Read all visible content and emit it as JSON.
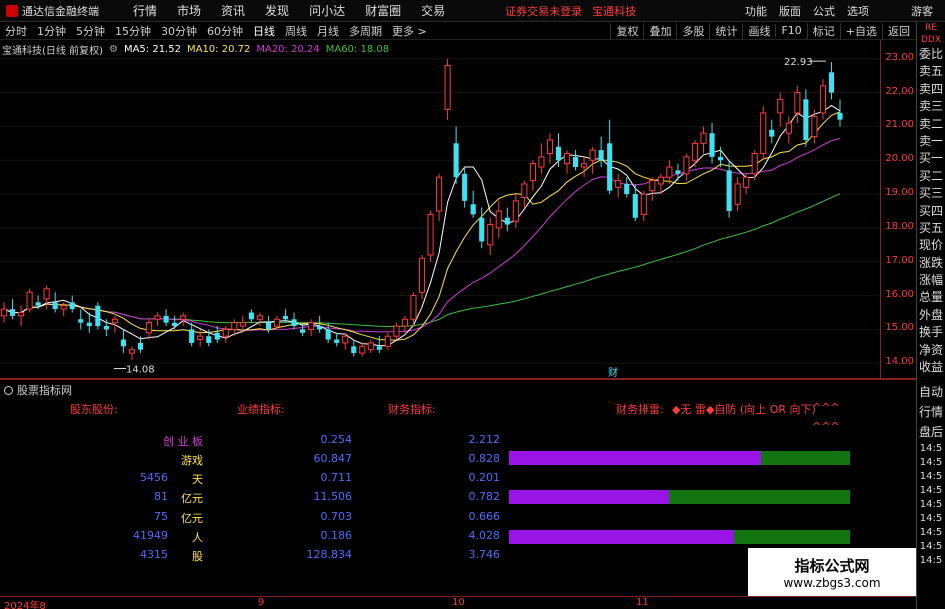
{
  "menubar": {
    "app_title": "通达信金融终端",
    "items": [
      "行情",
      "市场",
      "资讯",
      "发现",
      "问小达",
      "财富圈",
      "交易"
    ],
    "status_warn": "证券交易未登录",
    "status_stock": "宝通科技",
    "right_items": [
      "功能",
      "版面",
      "公式",
      "选项"
    ],
    "guest": "游客"
  },
  "toolbar": {
    "periods": [
      "分时",
      "1分钟",
      "5分钟",
      "15分钟",
      "30分钟",
      "60分钟",
      "日线",
      "周线",
      "月线",
      "多周期",
      "更多 >"
    ],
    "active": "日线",
    "buttons": [
      "复权",
      "叠加",
      "多股",
      "统计",
      "画线",
      "F10",
      "标记",
      "+自选",
      "返回"
    ]
  },
  "legend": {
    "stock": "宝通科技(日线 前复权)",
    "ma5": "MA5: 21.52",
    "ma10": "MA10: 20.72",
    "ma20": "MA20: 20.24",
    "ma60": "MA60: 18.08"
  },
  "colors": {
    "up": "#ff3b3b",
    "down": "#3fe0f0",
    "ma5": "#ffffff",
    "ma10": "#ffe34a",
    "ma20": "#d23ad6",
    "ma60": "#3fbf3f",
    "bar_purple": "#9b14e6",
    "bar_green": "#127512"
  },
  "chart_data": {
    "type": "candlestick",
    "ylim": [
      13.8,
      23.2
    ],
    "yticks": [
      "23.00",
      "22.00",
      "21.00",
      "20.00",
      "19.00",
      "18.00",
      "17.00",
      "16.00",
      "15.00",
      "14.00"
    ],
    "ytick_values": [
      23,
      22,
      21,
      20,
      19,
      18,
      17,
      16,
      15,
      14
    ],
    "high_label": "22.93",
    "low_label": "14.08",
    "marker": "财",
    "candles": [
      [
        15.4,
        15.8,
        15.2,
        15.6
      ],
      [
        15.6,
        15.9,
        15.3,
        15.4
      ],
      [
        15.4,
        15.7,
        15.1,
        15.5
      ],
      [
        15.6,
        16.2,
        15.5,
        16.1
      ],
      [
        15.8,
        16.0,
        15.6,
        15.7
      ],
      [
        15.9,
        16.3,
        15.6,
        16.2
      ],
      [
        15.8,
        16.1,
        15.5,
        15.6
      ],
      [
        15.6,
        15.8,
        15.4,
        15.7
      ],
      [
        15.8,
        16.0,
        15.5,
        15.6
      ],
      [
        15.3,
        15.6,
        15.0,
        15.2
      ],
      [
        15.2,
        15.5,
        14.9,
        15.1
      ],
      [
        15.7,
        15.8,
        15.0,
        15.1
      ],
      [
        15.1,
        15.3,
        14.8,
        15.0
      ],
      [
        15.2,
        15.4,
        14.9,
        15.3
      ],
      [
        14.7,
        15.0,
        14.3,
        14.5
      ],
      [
        14.3,
        14.5,
        14.1,
        14.4
      ],
      [
        14.6,
        14.8,
        14.3,
        14.4
      ],
      [
        14.9,
        15.3,
        14.7,
        15.2
      ],
      [
        15.3,
        15.5,
        15.1,
        15.4
      ],
      [
        15.4,
        15.6,
        15.1,
        15.2
      ],
      [
        15.2,
        15.4,
        15.0,
        15.1
      ],
      [
        15.3,
        15.5,
        15.1,
        15.4
      ],
      [
        15.0,
        15.2,
        14.5,
        14.6
      ],
      [
        14.7,
        15.0,
        14.5,
        14.8
      ],
      [
        14.8,
        15.0,
        14.5,
        14.6
      ],
      [
        14.9,
        15.1,
        14.6,
        14.7
      ],
      [
        14.8,
        15.1,
        14.6,
        15.0
      ],
      [
        15.0,
        15.3,
        14.8,
        15.2
      ],
      [
        15.1,
        15.4,
        14.9,
        15.2
      ],
      [
        15.5,
        15.6,
        15.2,
        15.3
      ],
      [
        15.3,
        15.5,
        15.1,
        15.4
      ],
      [
        15.2,
        15.4,
        14.9,
        15.0
      ],
      [
        15.1,
        15.4,
        15.0,
        15.3
      ],
      [
        15.4,
        15.6,
        15.2,
        15.3
      ],
      [
        15.3,
        15.5,
        15.0,
        15.1
      ],
      [
        15.0,
        15.2,
        14.8,
        14.9
      ],
      [
        15.0,
        15.3,
        14.8,
        15.2
      ],
      [
        15.1,
        15.4,
        14.9,
        15.0
      ],
      [
        15.0,
        15.2,
        14.6,
        14.7
      ],
      [
        14.7,
        14.9,
        14.5,
        14.6
      ],
      [
        14.6,
        14.9,
        14.4,
        14.8
      ],
      [
        14.5,
        14.7,
        14.2,
        14.3
      ],
      [
        14.3,
        14.6,
        14.2,
        14.5
      ],
      [
        14.4,
        14.7,
        14.3,
        14.6
      ],
      [
        14.5,
        14.8,
        14.3,
        14.4
      ],
      [
        14.5,
        14.9,
        14.4,
        14.8
      ],
      [
        14.8,
        15.2,
        14.7,
        15.1
      ],
      [
        15.1,
        15.4,
        14.9,
        15.3
      ],
      [
        15.3,
        16.1,
        15.1,
        16.0
      ],
      [
        16.1,
        17.2,
        15.9,
        17.1
      ],
      [
        17.2,
        18.5,
        17.0,
        18.4
      ],
      [
        18.5,
        19.6,
        18.2,
        19.5
      ],
      [
        21.5,
        23.0,
        21.2,
        22.8
      ],
      [
        20.5,
        21.0,
        19.3,
        19.5
      ],
      [
        19.6,
        19.8,
        18.6,
        18.8
      ],
      [
        18.7,
        19.1,
        18.3,
        18.4
      ],
      [
        18.3,
        18.6,
        17.4,
        17.6
      ],
      [
        17.5,
        18.3,
        17.2,
        18.1
      ],
      [
        18.0,
        18.8,
        17.7,
        18.5
      ],
      [
        18.3,
        18.6,
        17.9,
        18.1
      ],
      [
        18.2,
        19.0,
        18.0,
        18.8
      ],
      [
        18.9,
        19.4,
        18.6,
        19.3
      ],
      [
        19.4,
        20.0,
        19.1,
        19.9
      ],
      [
        19.8,
        20.5,
        19.6,
        20.1
      ],
      [
        20.2,
        20.8,
        19.9,
        20.6
      ],
      [
        20.4,
        20.8,
        19.8,
        20.0
      ],
      [
        19.9,
        20.3,
        19.6,
        20.2
      ],
      [
        20.1,
        20.3,
        19.7,
        19.8
      ],
      [
        19.8,
        20.1,
        19.5,
        19.9
      ],
      [
        20.0,
        20.4,
        19.6,
        20.3
      ],
      [
        20.3,
        20.7,
        19.8,
        20.0
      ],
      [
        20.5,
        21.2,
        19.0,
        19.1
      ],
      [
        19.2,
        19.6,
        18.9,
        19.4
      ],
      [
        19.3,
        19.5,
        18.9,
        19.0
      ],
      [
        19.0,
        19.3,
        18.2,
        18.3
      ],
      [
        18.4,
        19.1,
        18.2,
        19.0
      ],
      [
        19.1,
        19.5,
        18.8,
        19.4
      ],
      [
        19.3,
        19.6,
        19.0,
        19.5
      ],
      [
        19.5,
        20.0,
        19.3,
        19.8
      ],
      [
        19.7,
        19.9,
        19.4,
        19.6
      ],
      [
        19.6,
        20.2,
        19.4,
        20.1
      ],
      [
        20.0,
        20.6,
        19.8,
        20.5
      ],
      [
        20.5,
        21.0,
        20.2,
        20.8
      ],
      [
        20.8,
        21.1,
        19.9,
        20.1
      ],
      [
        20.1,
        20.4,
        19.8,
        20.0
      ],
      [
        19.7,
        20.0,
        18.3,
        18.5
      ],
      [
        18.7,
        19.5,
        18.5,
        19.3
      ],
      [
        19.2,
        19.6,
        19.0,
        19.5
      ],
      [
        19.6,
        20.3,
        19.4,
        20.2
      ],
      [
        20.2,
        21.6,
        20.0,
        21.4
      ],
      [
        20.9,
        21.2,
        20.5,
        20.7
      ],
      [
        21.4,
        22.0,
        21.0,
        21.8
      ],
      [
        20.8,
        21.3,
        20.5,
        21.1
      ],
      [
        21.4,
        22.2,
        21.1,
        22.0
      ],
      [
        21.8,
        22.1,
        20.4,
        20.6
      ],
      [
        20.7,
        21.5,
        20.5,
        21.3
      ],
      [
        21.4,
        22.4,
        21.2,
        22.2
      ],
      [
        22.6,
        22.9,
        21.8,
        22.0
      ],
      [
        21.4,
        21.8,
        21.0,
        21.2
      ]
    ]
  },
  "sub_panel": {
    "title": "股票指标网",
    "headers": [
      "股东股份:",
      "业绩指标:",
      "财务指标:",
      "财务排雷:"
    ],
    "risk_text": "◆无 雷◆自防 (向上 OR 向下)",
    "risk_marks": "^^^",
    "risk_marks2": "^^^",
    "rows": [
      {
        "label": "创 业 板",
        "v1": "",
        "v2": "0.254",
        "v3": "2.212"
      },
      {
        "label": "游戏",
        "v1": "",
        "v2": "60.847",
        "v3": "0.828"
      },
      {
        "label": "天",
        "v1": "5456",
        "v2": "0.711",
        "v3": "0.201"
      },
      {
        "label": "亿元",
        "v1": "81",
        "v2": "11.506",
        "v3": "0.782"
      },
      {
        "label": "亿元",
        "v1": "75",
        "v2": "0.703",
        "v3": "0.666"
      },
      {
        "label": "人",
        "v1": "41949",
        "v2": "0.186",
        "v3": "4.028"
      },
      {
        "label": "股",
        "v1": "4315",
        "v2": "128.834",
        "v3": "3.746"
      }
    ],
    "bars": [
      0.74,
      0.47,
      0.66
    ]
  },
  "time_axis": [
    "2024年8",
    "9",
    "10",
    "11"
  ],
  "side_panel": {
    "top_small": [
      "RE",
      "DDX"
    ],
    "items": [
      "委比",
      "卖五",
      "卖四",
      "卖三",
      "卖二",
      "卖一",
      "买一",
      "买二",
      "买三",
      "买四",
      "买五",
      "现价",
      "涨跌",
      "涨幅",
      "总量",
      "外盘",
      "换手",
      "净资",
      "收益"
    ],
    "lower_items": [
      "自动",
      "行情",
      "盘后"
    ],
    "times": [
      "14:5",
      "14:5",
      "14:5",
      "14:5",
      "14:5",
      "14:5",
      "14:5",
      "14:5",
      "14:5"
    ]
  },
  "watermark": {
    "title": "指标公式网",
    "url": "www.zbgs3.com"
  }
}
